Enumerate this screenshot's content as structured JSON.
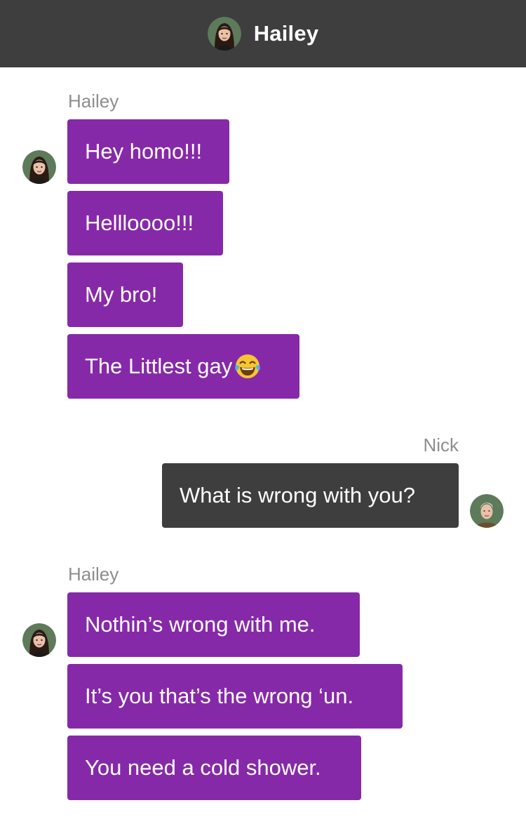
{
  "header": {
    "title": "Hailey",
    "avatar_icon": "hailey-avatar-icon"
  },
  "colors": {
    "header_bg": "#3e3e3e",
    "hailey_bubble": "#8629a8",
    "nick_bubble": "#3e3e3e",
    "sender_label": "#8e8e8e"
  },
  "groups": [
    {
      "sender": "Hailey",
      "messages": [
        "Hey homo!!!",
        "Helllောooo!!!",
        "My bro!",
        "The Littlest gay"
      ],
      "emoji_icon": "tears-of-joy-emoji-icon"
    },
    {
      "sender": "Nick",
      "messages": [
        "What is wrong with you?"
      ]
    },
    {
      "sender": "Hailey",
      "messages": [
        "Nothin’s wrong with me.",
        "It’s you that’s the wrong ‘un.",
        "You need a cold shower."
      ]
    }
  ]
}
